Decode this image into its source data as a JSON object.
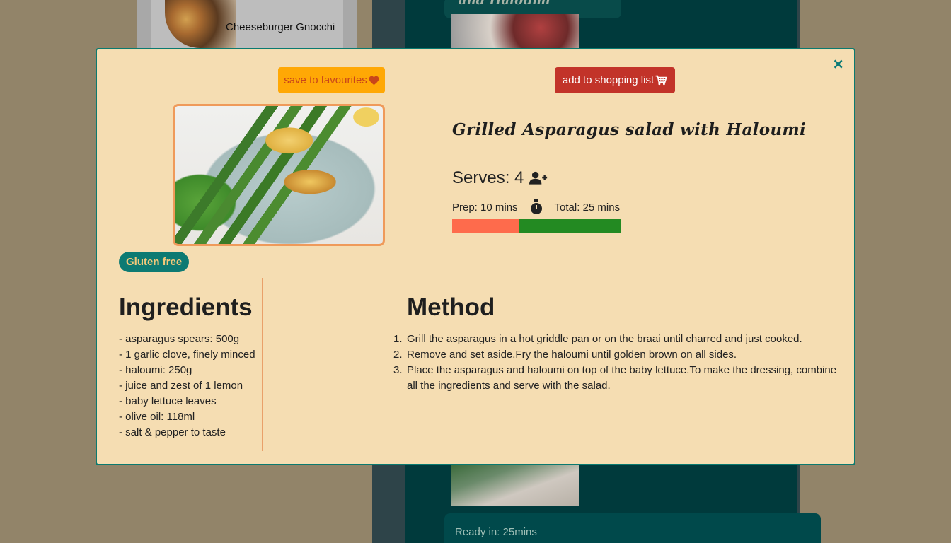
{
  "background": {
    "left_card_title": "Cheeseburger Gnocchi",
    "top_card_title": "and Haloumi",
    "ready_text": "Ready in: 25mins"
  },
  "modal": {
    "close_label": "×",
    "save_label": "save to favourites",
    "shop_label": "add to shopping list",
    "tag": "Gluten free",
    "title": "Grilled Asparagus salad with Haloumi",
    "serves_label": "Serves: 4",
    "prep_label": "Prep: 10 mins",
    "total_label": "Total: 25 mins",
    "prep_minutes": 10,
    "total_minutes": 25,
    "ingredients_heading": "Ingredients",
    "ingredients": [
      "- asparagus spears: 500g",
      "- 1 garlic clove, finely minced",
      "- haloumi: 250g",
      "- juice and zest of 1 lemon",
      "- baby lettuce leaves",
      "- olive oil: 118ml",
      "- salt & pepper to taste"
    ],
    "method_heading": "Method",
    "method": [
      "Grill the asparagus in a hot griddle pan or on the braai until charred and just cooked.",
      "Remove and set aside.Fry the haloumi until golden brown on all sides.",
      "Place the asparagus and haloumi on top of the baby lettuce.To make the dressing, combine all the ingredients and serve with the salad."
    ]
  },
  "colors": {
    "modal_bg": "#f5ddb2",
    "accent_teal": "#0c7a73",
    "save_bg": "#ffa805",
    "shop_bg": "#c23329",
    "prep_bar": "#fe6b4c",
    "cook_bar": "#238a22"
  },
  "icons": {
    "favourite": "heart-icon",
    "shopping": "cart-icon",
    "serves": "user-plus-icon",
    "timer": "stopwatch-icon",
    "close": "close-icon"
  }
}
